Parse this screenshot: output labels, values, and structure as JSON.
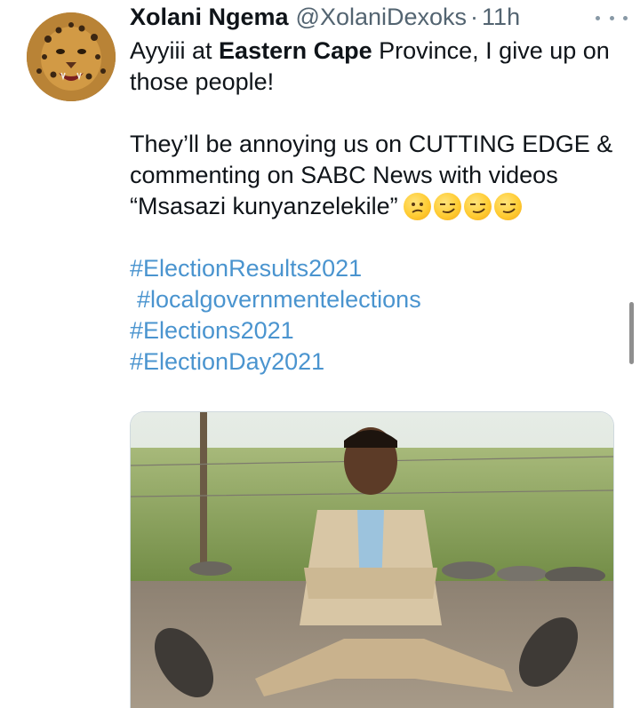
{
  "tweet": {
    "display_name": "Xolani Ngema",
    "handle": "@XolaniDexoks",
    "separator": "·",
    "time": "11h",
    "line1_pre": "Ayyiii at ",
    "line1_bold": "Eastern Cape",
    "line1_post": " Province, I give up on those people!",
    "line2": "They’ll be annoying us on CUTTING EDGE & commenting on SABC News with videos “Msasazi kunyanzelekile”",
    "emojis": [
      "confused-face",
      "smirking-face",
      "smirking-face",
      "smirking-face"
    ],
    "hashtags": [
      "#ElectionResults2021",
      "#localgovernmentelections",
      "#Elections2021",
      "#ElectionDay2021"
    ]
  },
  "colors": {
    "hashtag": "#4a94cf",
    "text": "#0f1419",
    "muted": "#536471"
  },
  "icons": {
    "more": "more-horizontal-icon",
    "avatar": "leopard-avatar"
  }
}
